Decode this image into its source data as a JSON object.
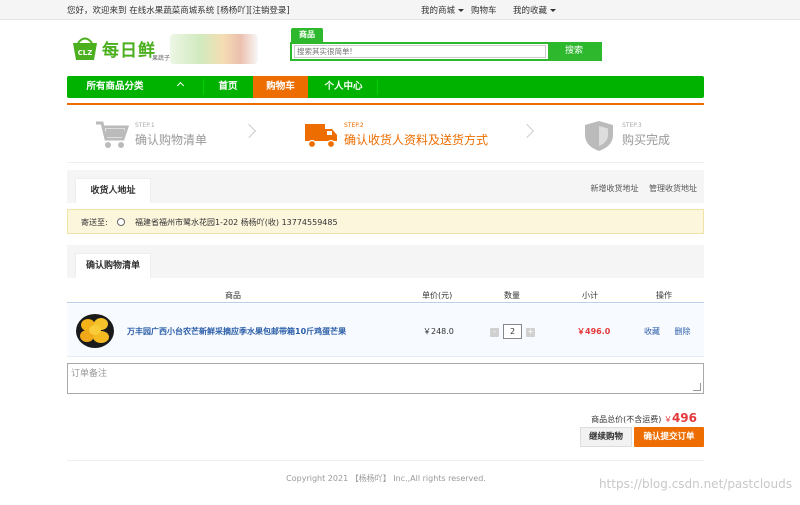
{
  "topbar": {
    "welcome": "您好，欢迎来到 在线水果蔬菜商城系统",
    "user_label": "[杨杨吖][",
    "logout": "注销登录",
    "user_end": "]",
    "my_mall": "我的商城",
    "cart": "购物车",
    "favorites": "我的收藏"
  },
  "logo": {
    "brand": "每日鲜",
    "sub": "果蔬子",
    "badge": "CLZ"
  },
  "search": {
    "tab": "商品",
    "placeholder": "搜索其实很简单!",
    "button": "搜索"
  },
  "nav": {
    "all_categories": "所有商品分类",
    "home": "首页",
    "cart": "购物车",
    "user_center": "个人中心"
  },
  "steps": [
    {
      "label": "STEP.1",
      "title": "确认购物清单",
      "icon": "cart-icon"
    },
    {
      "label": "STEP.2",
      "title": "确认收货人资料及送货方式",
      "icon": "truck-icon"
    },
    {
      "label": "STEP.3",
      "title": "购买完成",
      "icon": "shield-icon"
    }
  ],
  "address": {
    "tab": "收货人地址",
    "add_link": "新增收货地址",
    "manage_link": "管理收货地址",
    "ship_to": "寄送至:",
    "entry": "福建省福州市鹭水花园1-202  杨杨吖(收)  13774559485"
  },
  "cart": {
    "tab": "确认购物清单",
    "columns": [
      "商品",
      "单价(元)",
      "数量",
      "小计",
      "操作"
    ],
    "items": [
      {
        "name": "万丰园广西小台农芒新鲜采摘应季水果包邮带箱10斤鸡蛋芒果",
        "price": "￥248.0",
        "qty": "2",
        "subtotal": "￥496.0",
        "fav": "收藏",
        "del": "删除"
      }
    ]
  },
  "remark": {
    "placeholder": "订单备注"
  },
  "summary": {
    "label": "商品总价(不含运费)",
    "currency": "￥",
    "amount": "496",
    "continue": "继续购物",
    "submit": "确认提交订单"
  },
  "footer": {
    "copyright": "Copyright 2021 【杨杨吖】 Inc.,All rights reserved.",
    "watermark": "https://blog.csdn.net/pastclouds"
  },
  "colors": {
    "brand_green": "#00b200",
    "accent_orange": "#ed6d00",
    "price_red": "#e4393c"
  }
}
